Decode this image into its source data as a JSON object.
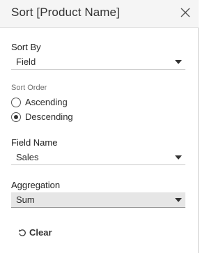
{
  "dialog": {
    "title": "Sort [Product Name]",
    "close_icon": "close-icon"
  },
  "sort_by": {
    "label": "Sort By",
    "value": "Field"
  },
  "sort_order": {
    "label": "Sort Order",
    "options": [
      {
        "label": "Ascending",
        "selected": false
      },
      {
        "label": "Descending",
        "selected": true
      }
    ]
  },
  "field_name": {
    "label": "Field Name",
    "value": "Sales"
  },
  "aggregation": {
    "label": "Aggregation",
    "value": "Sum"
  },
  "clear": {
    "label": "Clear",
    "icon": "reset-icon"
  },
  "colors": {
    "header_bg": "#f5f5f5",
    "filled_select_bg": "#e6e6e6",
    "text": "#2b2b2b",
    "muted_text": "#6f6f6f"
  }
}
